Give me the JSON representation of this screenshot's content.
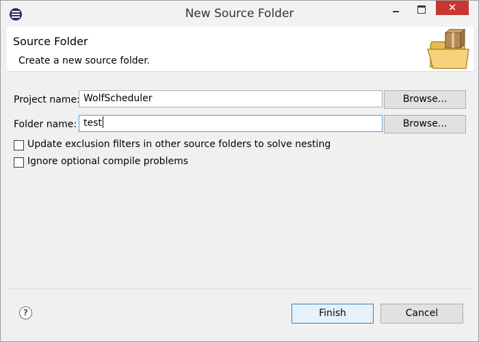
{
  "window": {
    "title": "New Source Folder",
    "close_glyph": "✕"
  },
  "header": {
    "title": "Source Folder",
    "description": "Create a new source folder."
  },
  "form": {
    "project_label": "Project name:",
    "project_value": "WolfScheduler",
    "folder_label": "Folder name:",
    "folder_value": "test",
    "browse_label": "Browse...",
    "update_exclusion_label": "Update exclusion filters in other source folders to solve nesting",
    "ignore_optional_label": "Ignore optional compile problems"
  },
  "footer": {
    "help_glyph": "?",
    "finish_label": "Finish",
    "cancel_label": "Cancel"
  },
  "icons": {
    "app": "eclipse-icon",
    "header": "source-folder-icon",
    "help": "help-icon"
  },
  "colors": {
    "close_button": "#c7372f",
    "focus_border": "#569de5",
    "default_button": "#e5f1fb"
  }
}
